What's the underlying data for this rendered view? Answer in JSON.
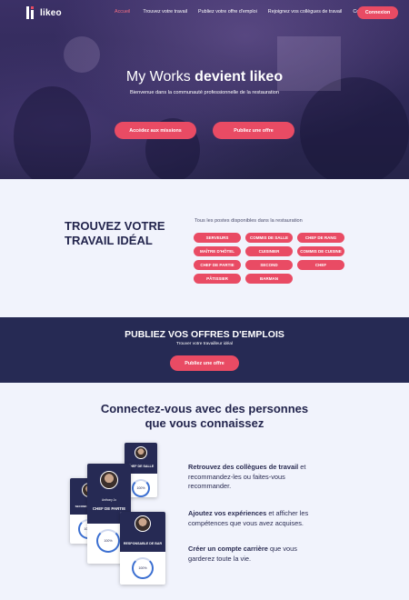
{
  "nav": {
    "logo_text": "likeo",
    "links": [
      {
        "label": "Accueil",
        "active": true
      },
      {
        "label": "Trouvez votre travail",
        "active": false
      },
      {
        "label": "Publiez votre offre d'emploi",
        "active": false
      },
      {
        "label": "Rejoignez vos collègues de travail",
        "active": false
      },
      {
        "label": "Contact",
        "active": false
      }
    ],
    "login_label": "Connexion"
  },
  "hero": {
    "title_regular": "My Works ",
    "title_bold": "devient likeo",
    "subtitle": "Bienvenue dans la communauté professionnelle de la restauration",
    "btn_missions": "Accédez aux missions",
    "btn_offre": "Publiez une offre"
  },
  "jobs": {
    "title_line1": "TROUVEZ VOTRE",
    "title_line2": "TRAVAIL IDÉAL",
    "subtitle": "Tous les postes disponibles dans la restauration",
    "tags": [
      "SERVEURS",
      "COMMIS DE SALLE",
      "CHEF DE RANG",
      "MAÎTRE D'HÔTEL",
      "CUISINIER",
      "COMMIS DE CUISINE",
      "CHEF DE PARTIE",
      "SECOND",
      "CHEF",
      "PÂTISSIER",
      "BARMAN"
    ]
  },
  "publish": {
    "title": "PUBLIEZ VOS OFFRES D'EMPLOIS",
    "subtitle": "Trouver votre travailleur idéal",
    "button": "Publiez une offre"
  },
  "connect": {
    "title_line1": "Connectez-vous avec des personnes",
    "title_line2": "que vous connaissez",
    "features": [
      {
        "bold": "Retrouvez des collègues de travail",
        "rest": " et recommandez-les ou faites-vous recommander."
      },
      {
        "bold": "Ajoutez vos expériences",
        "rest": " et afficher les compétences que vous avez acquises."
      },
      {
        "bold": "Créer un compte carrière",
        "rest": " que vous garderez toute la vie."
      }
    ],
    "cards": [
      {
        "role": "CHEF DE SALLE",
        "score": "100%"
      },
      {
        "role": "SECOND DE CUISINE",
        "score": "100%"
      },
      {
        "name": "Anthony Jo",
        "role": "CHEF DE PARTIE",
        "score": "100%"
      },
      {
        "role": "RESPONSABLE DE BAR",
        "score": "100%"
      }
    ]
  },
  "colors": {
    "accent": "#e94b64",
    "navy": "#262a54",
    "light_bg": "#f1f3fc"
  }
}
